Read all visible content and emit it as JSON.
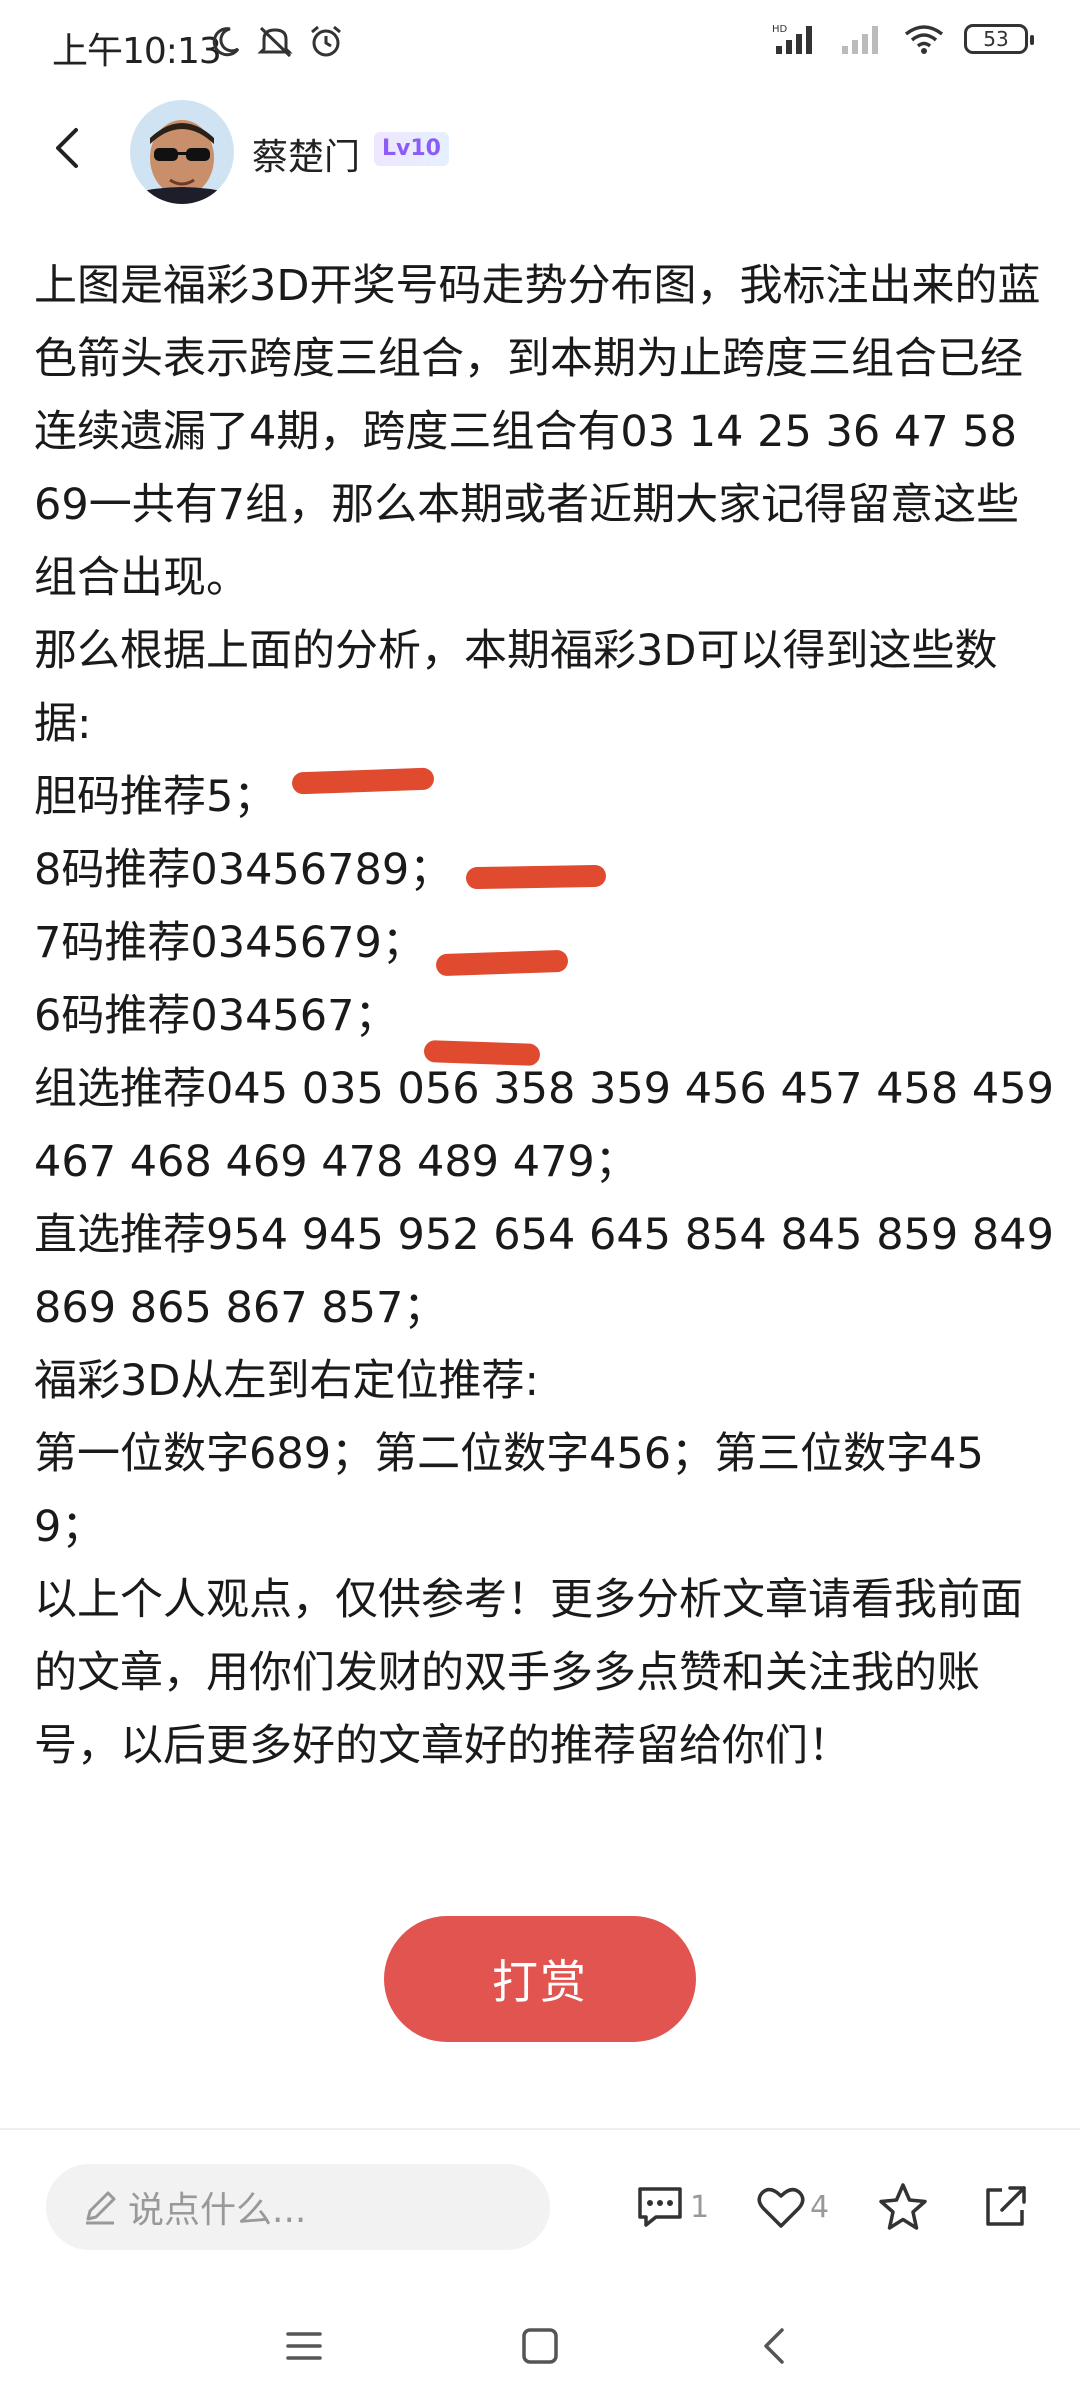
{
  "status": {
    "time": "上午10:13",
    "battery": "53",
    "icons_left": [
      "moon-icon",
      "mute-icon",
      "alarm-icon"
    ],
    "icons_right": [
      "hd-signal-icon",
      "signal-icon",
      "wifi-icon",
      "battery-icon"
    ]
  },
  "header": {
    "author_name": "蔡楚门",
    "level": "Lv10"
  },
  "article": {
    "paragraphs": [
      "上图是福彩3D开奖号码走势分布图，我标注出来的蓝色箭头表示跨度三组合，到本期为止跨度三组合已经连续遗漏了4期，跨度三组合有03 14 25 36 47 58 69一共有7组，那么本期或者近期大家记得留意这些组合出现。",
      "那么根据上面的分析，本期福彩3D可以得到这些数据:",
      "胆码推荐5；",
      "8码推荐03456789；",
      "7码推荐0345679；",
      "6码推荐034567；",
      "组选推荐045 035 056 358 359 456 457 458 459 467 468 469 478 489 479；",
      "直选推荐954 945 952 654 645 854 845 859 849 869 865 867 857；",
      "福彩3D从左到右定位推荐:",
      "第一位数字689；第二位数字456；第三位数字459；",
      "以上个人观点，仅供参考！更多分析文章请看我前面的文章，用你们发财的双手多多点赞和关注我的账号，以后更多好的文章好的推荐留给你们！"
    ]
  },
  "reward": {
    "label": "打赏"
  },
  "bottom_bar": {
    "comment_placeholder": "说点什么...",
    "comment_count": "1",
    "like_count": "4"
  },
  "colors": {
    "accent": "#e2544f",
    "marker": "#e04a2f",
    "level_badge": "#8b5cf6"
  }
}
